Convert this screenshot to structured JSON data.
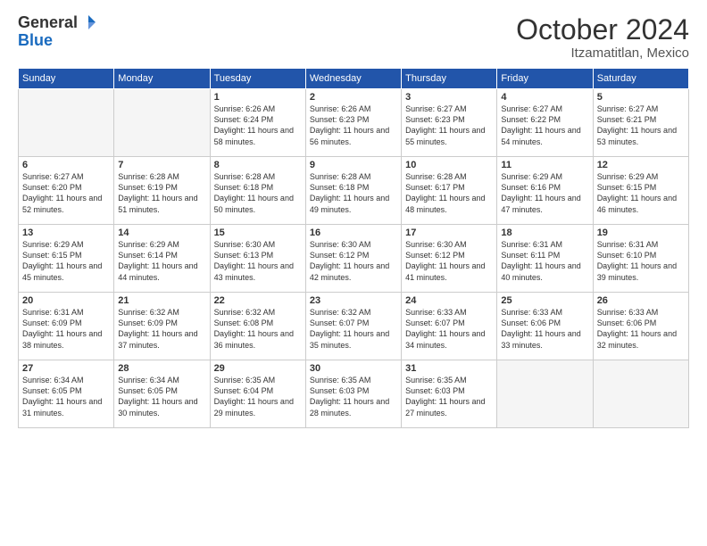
{
  "logo": {
    "general": "General",
    "blue": "Blue"
  },
  "title": "October 2024",
  "location": "Itzamatitlan, Mexico",
  "headers": [
    "Sunday",
    "Monday",
    "Tuesday",
    "Wednesday",
    "Thursday",
    "Friday",
    "Saturday"
  ],
  "weeks": [
    [
      {
        "day": "",
        "info": ""
      },
      {
        "day": "",
        "info": ""
      },
      {
        "day": "1",
        "info": "Sunrise: 6:26 AM\nSunset: 6:24 PM\nDaylight: 11 hours and 58 minutes."
      },
      {
        "day": "2",
        "info": "Sunrise: 6:26 AM\nSunset: 6:23 PM\nDaylight: 11 hours and 56 minutes."
      },
      {
        "day": "3",
        "info": "Sunrise: 6:27 AM\nSunset: 6:23 PM\nDaylight: 11 hours and 55 minutes."
      },
      {
        "day": "4",
        "info": "Sunrise: 6:27 AM\nSunset: 6:22 PM\nDaylight: 11 hours and 54 minutes."
      },
      {
        "day": "5",
        "info": "Sunrise: 6:27 AM\nSunset: 6:21 PM\nDaylight: 11 hours and 53 minutes."
      }
    ],
    [
      {
        "day": "6",
        "info": "Sunrise: 6:27 AM\nSunset: 6:20 PM\nDaylight: 11 hours and 52 minutes."
      },
      {
        "day": "7",
        "info": "Sunrise: 6:28 AM\nSunset: 6:19 PM\nDaylight: 11 hours and 51 minutes."
      },
      {
        "day": "8",
        "info": "Sunrise: 6:28 AM\nSunset: 6:18 PM\nDaylight: 11 hours and 50 minutes."
      },
      {
        "day": "9",
        "info": "Sunrise: 6:28 AM\nSunset: 6:18 PM\nDaylight: 11 hours and 49 minutes."
      },
      {
        "day": "10",
        "info": "Sunrise: 6:28 AM\nSunset: 6:17 PM\nDaylight: 11 hours and 48 minutes."
      },
      {
        "day": "11",
        "info": "Sunrise: 6:29 AM\nSunset: 6:16 PM\nDaylight: 11 hours and 47 minutes."
      },
      {
        "day": "12",
        "info": "Sunrise: 6:29 AM\nSunset: 6:15 PM\nDaylight: 11 hours and 46 minutes."
      }
    ],
    [
      {
        "day": "13",
        "info": "Sunrise: 6:29 AM\nSunset: 6:15 PM\nDaylight: 11 hours and 45 minutes."
      },
      {
        "day": "14",
        "info": "Sunrise: 6:29 AM\nSunset: 6:14 PM\nDaylight: 11 hours and 44 minutes."
      },
      {
        "day": "15",
        "info": "Sunrise: 6:30 AM\nSunset: 6:13 PM\nDaylight: 11 hours and 43 minutes."
      },
      {
        "day": "16",
        "info": "Sunrise: 6:30 AM\nSunset: 6:12 PM\nDaylight: 11 hours and 42 minutes."
      },
      {
        "day": "17",
        "info": "Sunrise: 6:30 AM\nSunset: 6:12 PM\nDaylight: 11 hours and 41 minutes."
      },
      {
        "day": "18",
        "info": "Sunrise: 6:31 AM\nSunset: 6:11 PM\nDaylight: 11 hours and 40 minutes."
      },
      {
        "day": "19",
        "info": "Sunrise: 6:31 AM\nSunset: 6:10 PM\nDaylight: 11 hours and 39 minutes."
      }
    ],
    [
      {
        "day": "20",
        "info": "Sunrise: 6:31 AM\nSunset: 6:09 PM\nDaylight: 11 hours and 38 minutes."
      },
      {
        "day": "21",
        "info": "Sunrise: 6:32 AM\nSunset: 6:09 PM\nDaylight: 11 hours and 37 minutes."
      },
      {
        "day": "22",
        "info": "Sunrise: 6:32 AM\nSunset: 6:08 PM\nDaylight: 11 hours and 36 minutes."
      },
      {
        "day": "23",
        "info": "Sunrise: 6:32 AM\nSunset: 6:07 PM\nDaylight: 11 hours and 35 minutes."
      },
      {
        "day": "24",
        "info": "Sunrise: 6:33 AM\nSunset: 6:07 PM\nDaylight: 11 hours and 34 minutes."
      },
      {
        "day": "25",
        "info": "Sunrise: 6:33 AM\nSunset: 6:06 PM\nDaylight: 11 hours and 33 minutes."
      },
      {
        "day": "26",
        "info": "Sunrise: 6:33 AM\nSunset: 6:06 PM\nDaylight: 11 hours and 32 minutes."
      }
    ],
    [
      {
        "day": "27",
        "info": "Sunrise: 6:34 AM\nSunset: 6:05 PM\nDaylight: 11 hours and 31 minutes."
      },
      {
        "day": "28",
        "info": "Sunrise: 6:34 AM\nSunset: 6:05 PM\nDaylight: 11 hours and 30 minutes."
      },
      {
        "day": "29",
        "info": "Sunrise: 6:35 AM\nSunset: 6:04 PM\nDaylight: 11 hours and 29 minutes."
      },
      {
        "day": "30",
        "info": "Sunrise: 6:35 AM\nSunset: 6:03 PM\nDaylight: 11 hours and 28 minutes."
      },
      {
        "day": "31",
        "info": "Sunrise: 6:35 AM\nSunset: 6:03 PM\nDaylight: 11 hours and 27 minutes."
      },
      {
        "day": "",
        "info": ""
      },
      {
        "day": "",
        "info": ""
      }
    ]
  ]
}
